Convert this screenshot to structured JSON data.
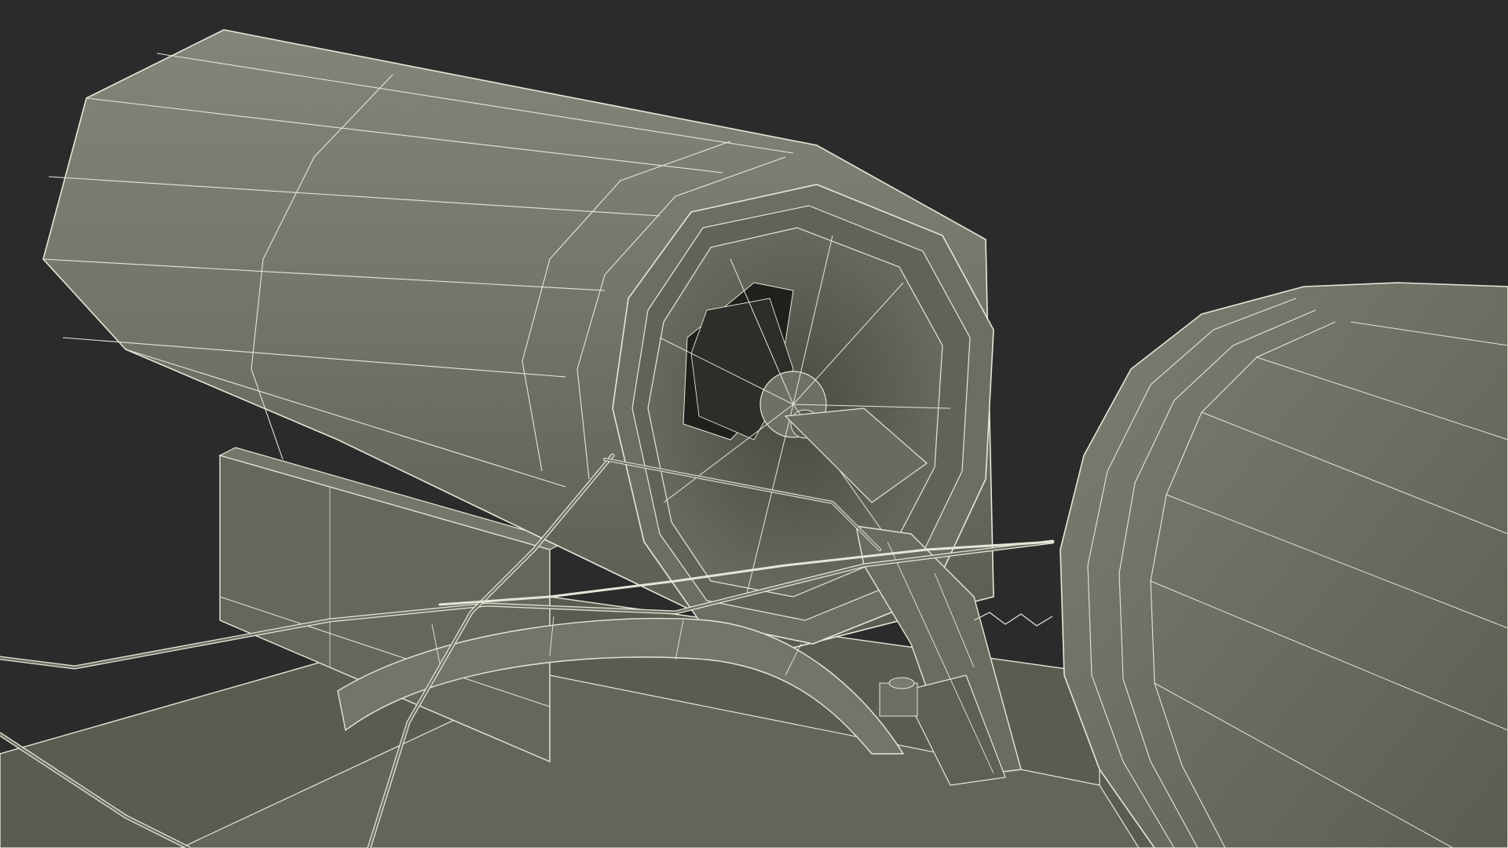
{
  "scene": {
    "description_visible_text": "",
    "render_style": "wireframe-over-shaded",
    "colors": {
      "background": "#2b2b2b",
      "surface_light": "#7c7c70",
      "surface_mid": "#6a6a5f",
      "surface_dark": "#55554c",
      "surface_shadow": "#3e3e37",
      "interior_dark": "#1f1f1c",
      "wire": "#e6e6d8"
    },
    "objects": [
      {
        "name": "left-cylinder-tank"
      },
      {
        "name": "right-cylinder-tank"
      },
      {
        "name": "support-stand"
      },
      {
        "name": "base-platform"
      },
      {
        "name": "tow-hitch-arm"
      },
      {
        "name": "cable-lines"
      }
    ]
  }
}
